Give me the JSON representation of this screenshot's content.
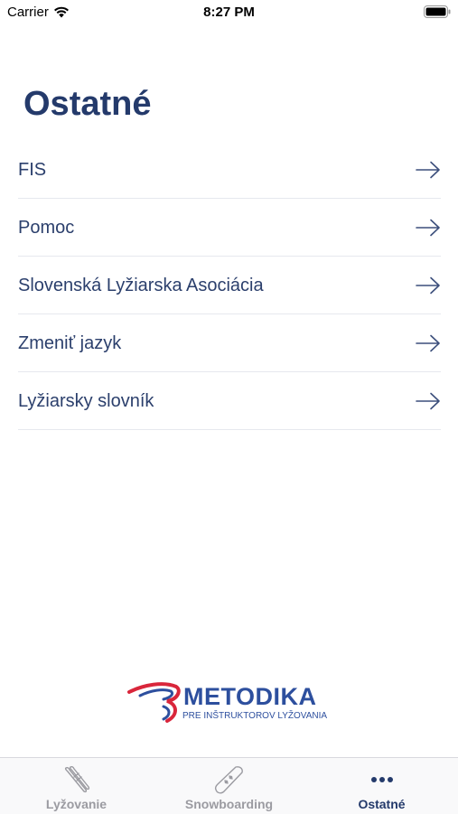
{
  "status_bar": {
    "carrier": "Carrier",
    "time": "8:27 PM"
  },
  "page": {
    "title": "Ostatné"
  },
  "menu": {
    "items": [
      {
        "label": "FIS"
      },
      {
        "label": "Pomoc"
      },
      {
        "label": "Slovenská Lyžiarska Asociácia"
      },
      {
        "label": "Zmeniť jazyk"
      },
      {
        "label": "Lyžiarsky slovník"
      }
    ]
  },
  "logo": {
    "title": "METODIKA",
    "subtitle": "PRE INŠTRUKTOROV LYŽOVANIA"
  },
  "tab_bar": {
    "tabs": [
      {
        "label": "Lyžovanie",
        "icon": "skis-icon",
        "active": false
      },
      {
        "label": "Snowboarding",
        "icon": "snowboard-icon",
        "active": false
      },
      {
        "label": "Ostatné",
        "icon": "more-dots-icon",
        "active": true
      }
    ]
  },
  "colors": {
    "primary": "#243a6b",
    "inactive_tab": "#9b9ba1",
    "logo_blue": "#2d4f9e",
    "logo_red": "#d9263b"
  }
}
